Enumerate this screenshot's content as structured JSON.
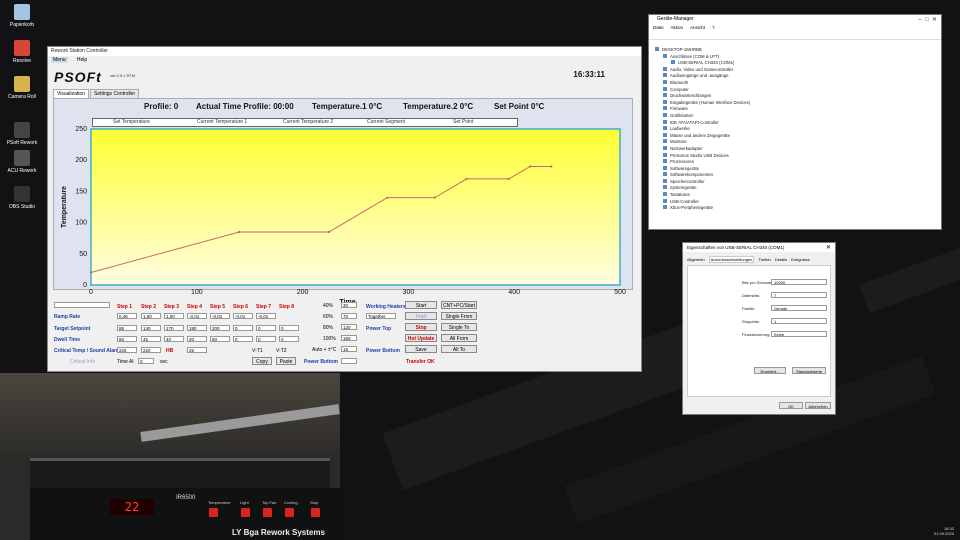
{
  "desktop": {
    "icons": [
      {
        "label": "Papierkorb",
        "color": "#9fc4e8"
      },
      {
        "label": "Resolve",
        "color": "#d9453b"
      },
      {
        "label": "Camera Roll",
        "color": "#d8b24a"
      },
      {
        "label": "PSoft Rework",
        "color": "#444"
      },
      {
        "label": "ACU Rework",
        "color": "#555"
      },
      {
        "label": "OBS Studio",
        "color": "#333"
      }
    ]
  },
  "rework": {
    "title": "Rework Station Controller",
    "menu": [
      "Menu",
      "Help"
    ],
    "logo": "PSOFt",
    "version": "ver.0.9.1 RTM",
    "clock": "16:33:11",
    "tabs": [
      "Visualization",
      "Settings Controller"
    ],
    "header": {
      "profile": "Profile: 0",
      "actual_time": "Actual Time Profile: 00:00",
      "temp1": "Temperature.1  0°C",
      "temp2": "Temperature.2  0°C",
      "setpoint": "Set Point 0°C"
    },
    "legend": [
      "Set Temperature",
      "Current Temperature 1",
      "Current Temperature 2",
      "Current Segment",
      "Set Point"
    ],
    "steps": [
      "Step 1",
      "Step 2",
      "Step 3",
      "Step 4",
      "Step 5",
      "Step 6",
      "Step 7",
      "Step 8"
    ],
    "rows": [
      {
        "label": "Ramp Rate",
        "values": [
          "0,46",
          "1,00",
          "1,00",
          "-0,01",
          "-0,01",
          "-0,01",
          "-0,01"
        ]
      },
      {
        "label": "Target Setpoint",
        "values": [
          "85",
          "140",
          "170",
          "190",
          "200",
          "0",
          "0",
          "0"
        ]
      },
      {
        "label": "Dwell Time",
        "values": [
          "80",
          "45",
          "40",
          "20",
          "50",
          "0",
          "0",
          "0"
        ]
      },
      {
        "label": "Critical Temp / Sound Alarm",
        "values": [
          "225",
          "220"
        ]
      }
    ],
    "hb_label": "HB",
    "hb_value": "25",
    "t1_label": "V-T1",
    "t2_label": "V-T2",
    "timeal_label": "Time Al",
    "timeal_value": "0",
    "timeal_unit": "sec",
    "dimmed_label": "Critical Info",
    "copy_label": "Copy",
    "paste_label": "Paste",
    "power_labels": [
      "40%",
      "60%",
      "80%",
      "100%"
    ],
    "power_values": [
      "30",
      "70",
      "120",
      "160"
    ],
    "auto_label": "Auto + ±°C",
    "auto_value": "15",
    "working_heaters": "Working Heaters",
    "together": "Together",
    "power_top": "Power Top",
    "power_bottom": "Power Bottom",
    "power_bottom2": "Power Bottom",
    "buttons": {
      "start": "Start",
      "hold": "Hold",
      "stop": "Stop",
      "hot_update": "Hot Update",
      "save": "Save",
      "cnt": "CNT+PC/Start",
      "single_from": "Single From",
      "single_to": "Single To",
      "all_from": "All From",
      "all_to": "All To"
    },
    "transfer": "Transfer OK"
  },
  "chart_data": {
    "type": "line",
    "x": [
      0,
      140,
      225,
      280,
      325,
      355,
      395,
      415,
      435
    ],
    "series": [
      {
        "name": "Set Temperature",
        "values": [
          20,
          85,
          85,
          140,
          140,
          170,
          170,
          190,
          190
        ]
      }
    ],
    "xlabel": "Time",
    "ylabel": "Temperature",
    "xlim": [
      0,
      500
    ],
    "ylim": [
      0,
      250
    ],
    "xticks": [
      "0",
      "100",
      "200",
      "300",
      "400",
      "500"
    ],
    "yticks": [
      "0",
      "50",
      "100",
      "150",
      "200",
      "250"
    ],
    "grid": false,
    "legend": "top",
    "colors": {
      "line": "#c86a6a",
      "plot_bg_top": "#ffff33",
      "plot_bg_bottom": "#fffde0",
      "border": "#3ab0c8"
    }
  },
  "devmgr": {
    "title": "Geräte-Manager",
    "menu": [
      "Datei",
      "Aktion",
      "Ansicht",
      "?"
    ],
    "items": [
      "DESKTOP-1MHRBB",
      "Anschlüsse (COM & LPT)",
      "USB-SERIAL CH340 (COM1)",
      "Audio, Video und Gamecontroller",
      "Audioeingänge und -ausgänge",
      "Bluetooth",
      "Computer",
      "Druckwarteschlangen",
      "Eingabegeräte (Human Interface Devices)",
      "Firmware",
      "Grafikkarten",
      "IDE ATA/ATAPI-Controller",
      "Laufwerke",
      "Mäuse und andere Zeigegeräte",
      "Monitore",
      "Netzwerkadapter",
      "PreSonus Studio USB Devices",
      "Prozessoren",
      "Softwaregeräte",
      "Softwarekomponenten",
      "Speichercontroller",
      "Systemgeräte",
      "Tastaturen",
      "USB-Controller",
      "Xbox-Peripheriegeräte"
    ]
  },
  "props": {
    "title": "Eigenschaften von USB-SERIAL CH340 (COM1)",
    "tabs": [
      "Allgemein",
      "Anschlusseinstellungen",
      "Treiber",
      "Details",
      "Ereignisse"
    ],
    "fields": [
      {
        "label": "Bits pro Sekunde:",
        "value": "19200"
      },
      {
        "label": "Datenbits:",
        "value": "7"
      },
      {
        "label": "Parität:",
        "value": "Gerade"
      },
      {
        "label": "Stoppbits:",
        "value": "1"
      },
      {
        "label": "Flusssteuerung:",
        "value": "Keine"
      }
    ],
    "advanced": "Erweitert...",
    "defaults": "Standardwerte",
    "ok": "OK",
    "cancel": "Abbrechen"
  },
  "camera": {
    "display_value": "22",
    "brand": "LY  Bga Rework  Systems",
    "model": "IR6500",
    "labels": [
      "Temperature",
      "Light",
      "Top Fan",
      "Cooling",
      "Stop"
    ]
  },
  "taskbar": {
    "time": "16:33",
    "date": "01.09.2020"
  }
}
